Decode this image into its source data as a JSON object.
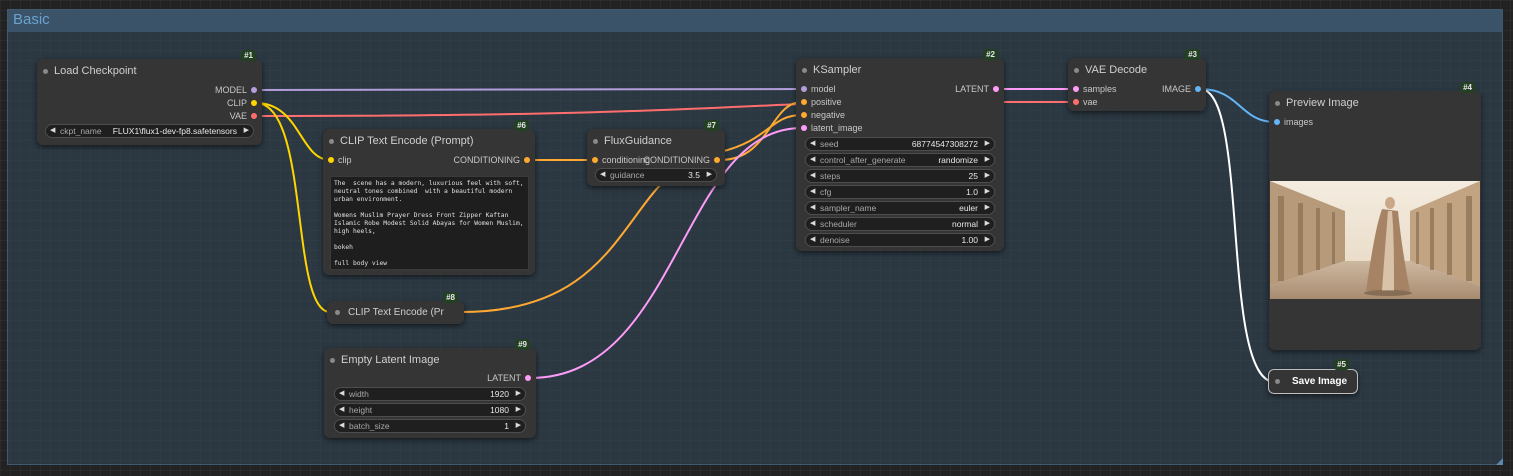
{
  "group": {
    "title": "Basic"
  },
  "colors": {
    "model": "#b39ddb",
    "clip": "#ffd500",
    "vae": "#ff6e6e",
    "conditioning": "#ffa931",
    "latent": "#ff9cf9",
    "image": "#64b5f6",
    "save": "#ffffff"
  },
  "nodes": {
    "load_checkpoint": {
      "id": "#1",
      "title": "Load Checkpoint",
      "outputs": [
        "MODEL",
        "CLIP",
        "VAE"
      ],
      "widget": {
        "name": "ckpt_name",
        "value": "FLUX1\\flux1-dev-fp8.safetensors"
      }
    },
    "ksampler": {
      "id": "#2",
      "title": "KSampler",
      "inputs": [
        "model",
        "positive",
        "negative",
        "latent_image"
      ],
      "output": "LATENT",
      "widgets": [
        {
          "name": "seed",
          "value": "687745473082​72"
        },
        {
          "name": "control_after_generate",
          "value": "randomize"
        },
        {
          "name": "steps",
          "value": "25"
        },
        {
          "name": "cfg",
          "value": "1.0"
        },
        {
          "name": "sampler_name",
          "value": "euler"
        },
        {
          "name": "scheduler",
          "value": "normal"
        },
        {
          "name": "denoise",
          "value": "1.00"
        }
      ]
    },
    "vae_decode": {
      "id": "#3",
      "title": "VAE Decode",
      "inputs": [
        "samples",
        "vae"
      ],
      "output": "IMAGE"
    },
    "preview_image": {
      "id": "#4",
      "title": "Preview Image",
      "input": "images"
    },
    "save_image": {
      "id": "#5",
      "title": "Save Image"
    },
    "clip_text_encode": {
      "id": "#6",
      "title": "CLIP Text Encode (Prompt)",
      "input": "clip",
      "output": "CONDITIONING",
      "text": "The  scene has a modern, luxurious feel with soft, neutral tones combined  with a beautiful modern urban environment.\n\nWomens Muslim Prayer Dress Front Zipper Kaftan Islamic Robe Modest Solid Abayas for Women Muslim, high heels,\n\nbokeh\n\nfull body view"
    },
    "flux_guidance": {
      "id": "#7",
      "title": "FluxGuidance",
      "input": "conditioning",
      "output": "CONDITIONING",
      "widget": {
        "name": "guidance",
        "value": "3.5"
      }
    },
    "clip_text_encode_collapsed": {
      "id": "#8",
      "title": "CLIP Text Encode (Pr"
    },
    "empty_latent": {
      "id": "#9",
      "title": "Empty Latent Image",
      "output": "LATENT",
      "widgets": [
        {
          "name": "width",
          "value": "1920"
        },
        {
          "name": "height",
          "value": "1080"
        },
        {
          "name": "batch_size",
          "value": "1"
        }
      ]
    }
  }
}
